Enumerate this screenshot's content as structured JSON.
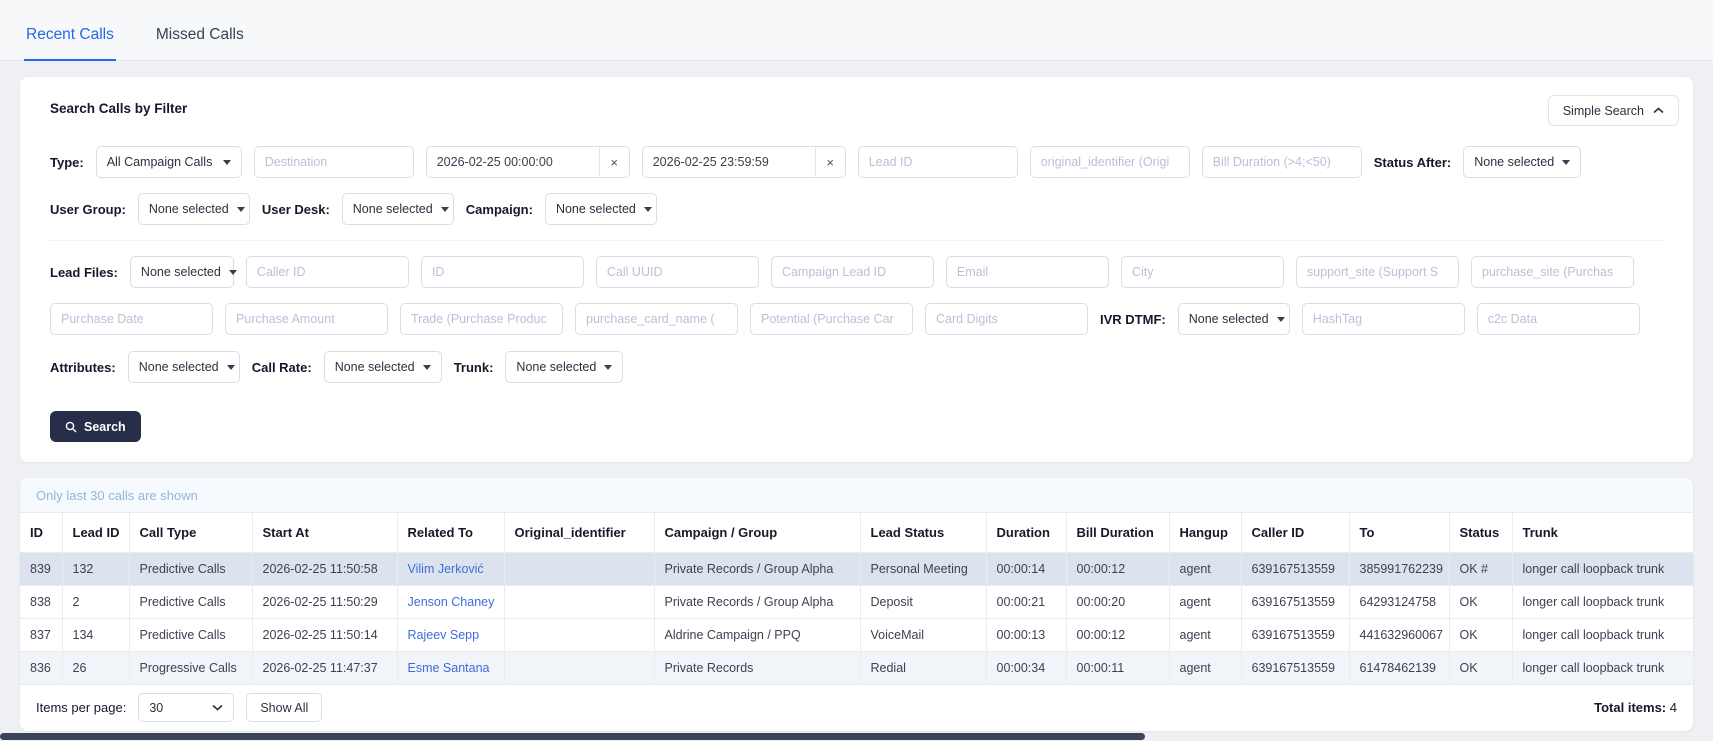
{
  "colors": {
    "accent_blue": "#2468e5",
    "link_blue": "#3d6ed8",
    "dark_button": "#272e49",
    "notice_text": "#92b6dc"
  },
  "icons": {
    "clear": "×"
  },
  "tabs": {
    "recent": "Recent Calls",
    "missed": "Missed Calls"
  },
  "search": {
    "title": "Search Calls by Filter",
    "toggle_label": "Simple Search",
    "type_label": "Type:",
    "type_value": "All Campaign Calls",
    "destination_ph": "Destination",
    "date_from_value": "2026-02-25 00:00:00",
    "date_to_value": "2026-02-25 23:59:59",
    "lead_id_ph": "Lead ID",
    "original_identifier_ph": "original_identifier (Origi",
    "bill_duration_ph": "Bill Duration (>4;<50)",
    "status_after_label": "Status After:",
    "status_after_value": "None selected",
    "user_group_label": "User Group:",
    "user_group_value": "None selected",
    "user_desk_label": "User Desk:",
    "user_desk_value": "None selected",
    "campaign_label": "Campaign:",
    "campaign_value": "None selected",
    "lead_files_label": "Lead Files:",
    "lead_files_value": "None selected",
    "caller_id_ph": "Caller ID",
    "id_ph": "ID",
    "call_uuid_ph": "Call UUID",
    "campaign_lead_id_ph": "Campaign Lead ID",
    "email_ph": "Email",
    "city_ph": "City",
    "support_site_ph": "support_site (Support S",
    "purchase_site_ph": "purchase_site (Purchas",
    "purchase_date_ph": "Purchase Date",
    "purchase_amount_ph": "Purchase Amount",
    "trade_ph": "Trade (Purchase Produc",
    "purchase_card_name_ph": "purchase_card_name (",
    "potential_ph": "Potential (Purchase Car",
    "card_digits_ph": "Card Digits",
    "ivr_dtmf_label": "IVR DTMF:",
    "ivr_dtmf_value": "None selected",
    "hashtag_ph": "HashTag",
    "c2c_ph": "c2c Data",
    "attributes_label": "Attributes:",
    "attributes_value": "None selected",
    "call_rate_label": "Call Rate:",
    "call_rate_value": "None selected",
    "trunk_label": "Trunk:",
    "trunk_value": "None selected",
    "search_button_label": "Search"
  },
  "results": {
    "notice": "Only last 30 calls are shown",
    "columns": [
      "ID",
      "Lead ID",
      "Call Type",
      "Start At",
      "Related To",
      "Original_identifier",
      "Campaign / Group",
      "Lead Status",
      "Duration",
      "Bill Duration",
      "Hangup",
      "Caller ID",
      "To",
      "Status",
      "Trunk"
    ],
    "rows": [
      {
        "id": "839",
        "lead_id": "132",
        "call_type": "Predictive Calls",
        "start_at": "2026-02-25 11:50:58",
        "related_to": "Vilim Jerković",
        "original_identifier": "",
        "campaign_group": "Private Records / Group Alpha",
        "lead_status": "Personal Meeting",
        "duration": "00:00:14",
        "bill_duration": "00:00:12",
        "hangup": "agent",
        "caller_id": "639167513559",
        "to": "385991762239",
        "status": "OK #",
        "trunk": "longer call loopback trunk"
      },
      {
        "id": "838",
        "lead_id": "2",
        "call_type": "Predictive Calls",
        "start_at": "2026-02-25 11:50:29",
        "related_to": "Jenson Chaney",
        "original_identifier": "",
        "campaign_group": "Private Records / Group Alpha",
        "lead_status": "Deposit",
        "duration": "00:00:21",
        "bill_duration": "00:00:20",
        "hangup": "agent",
        "caller_id": "639167513559",
        "to": "64293124758",
        "status": "OK",
        "trunk": "longer call loopback trunk"
      },
      {
        "id": "837",
        "lead_id": "134",
        "call_type": "Predictive Calls",
        "start_at": "2026-02-25 11:50:14",
        "related_to": "Rajeev Sepp",
        "original_identifier": "",
        "campaign_group": "Aldrine Campaign / PPQ",
        "lead_status": "VoiceMail",
        "duration": "00:00:13",
        "bill_duration": "00:00:12",
        "hangup": "agent",
        "caller_id": "639167513559",
        "to": "441632960067",
        "status": "OK",
        "trunk": "longer call loopback trunk"
      },
      {
        "id": "836",
        "lead_id": "26",
        "call_type": "Progressive Calls",
        "start_at": "2026-02-25 11:47:37",
        "related_to": "Esme Santana",
        "original_identifier": "",
        "campaign_group": "Private Records",
        "lead_status": "Redial",
        "duration": "00:00:34",
        "bill_duration": "00:00:11",
        "hangup": "agent",
        "caller_id": "639167513559",
        "to": "61478462139",
        "status": "OK",
        "trunk": "longer call loopback trunk"
      }
    ],
    "footer": {
      "items_per_page_label": "Items per page:",
      "items_per_page_value": "30",
      "show_all_label": "Show All",
      "total_label": "Total items:",
      "total_value": "4"
    }
  }
}
